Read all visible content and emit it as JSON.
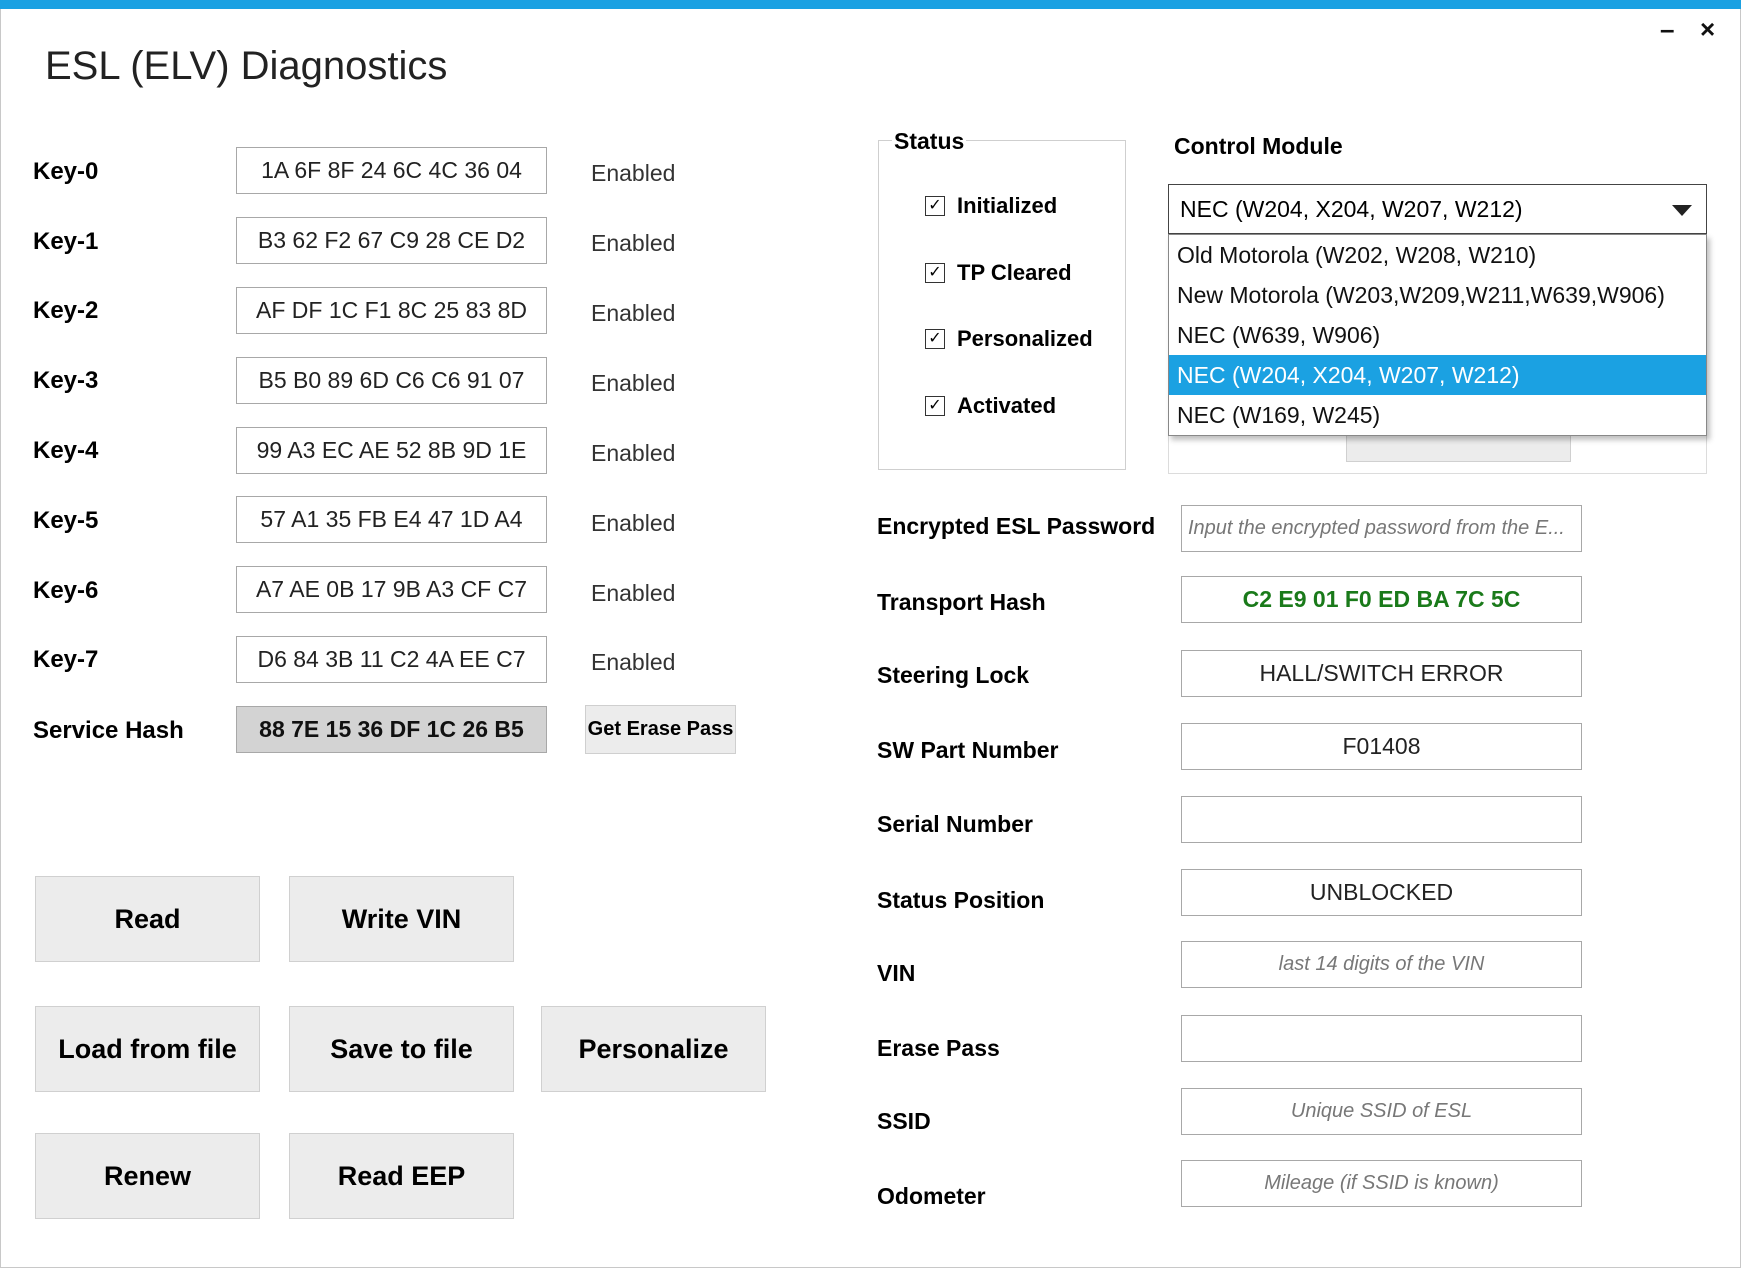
{
  "window": {
    "title": "ESL (ELV) Diagnostics",
    "minimize_label": "–",
    "close_label": "×",
    "accent_color": "#1ba1e2"
  },
  "keys": [
    {
      "label": "Key-0",
      "value": "1A 6F 8F 24 6C 4C 36 04",
      "status": "Enabled"
    },
    {
      "label": "Key-1",
      "value": "B3 62 F2 67 C9 28 CE D2",
      "status": "Enabled"
    },
    {
      "label": "Key-2",
      "value": "AF DF 1C F1 8C 25 83 8D",
      "status": "Enabled"
    },
    {
      "label": "Key-3",
      "value": "B5 B0 89 6D C6 C6 91 07",
      "status": "Enabled"
    },
    {
      "label": "Key-4",
      "value": "99 A3 EC AE 52 8B 9D 1E",
      "status": "Enabled"
    },
    {
      "label": "Key-5",
      "value": "57 A1 35 FB E4 47 1D A4",
      "status": "Enabled"
    },
    {
      "label": "Key-6",
      "value": "A7 AE 0B 17 9B A3 CF C7",
      "status": "Enabled"
    },
    {
      "label": "Key-7",
      "value": "D6 84 3B 11 C2 4A EE C7",
      "status": "Enabled"
    }
  ],
  "service_hash": {
    "label": "Service Hash",
    "value": "88 7E 15 36 DF 1C 26 B5",
    "button_label": "Get Erase Pass"
  },
  "buttons": {
    "read": "Read",
    "write_vin": "Write VIN",
    "load_from_file": "Load from file",
    "save_to_file": "Save to file",
    "personalize": "Personalize",
    "renew": "Renew",
    "read_eep": "Read EEP"
  },
  "status_group": {
    "title": "Status",
    "items": [
      {
        "label": "Initialized",
        "checked": true
      },
      {
        "label": "TP Cleared",
        "checked": true
      },
      {
        "label": "Personalized",
        "checked": true
      },
      {
        "label": "Activated",
        "checked": true
      }
    ],
    "check_glyph": "✓"
  },
  "control_module": {
    "label": "Control Module",
    "selected": "NEC (W204, X204, W207, W212)",
    "options": [
      "Old Motorola (W202, W208, W210)",
      "New Motorola (W203,W209,W211,W639,W906)",
      "NEC (W639, W906)",
      "NEC (W204, X204, W207, W212)",
      "NEC (W169, W245)"
    ],
    "selected_index": 3
  },
  "fields": {
    "encrypted_password": {
      "label": "Encrypted ESL Password",
      "value": "",
      "placeholder": "Input the encrypted password from the E..."
    },
    "transport_hash": {
      "label": "Transport Hash",
      "value": "C2 E9 01 F0 ED BA 7C 5C"
    },
    "steering_lock": {
      "label": "Steering Lock",
      "value": "HALL/SWITCH ERROR"
    },
    "sw_part_number": {
      "label": "SW Part Number",
      "value": "F01408"
    },
    "serial_number": {
      "label": "Serial Number",
      "value": ""
    },
    "status_position": {
      "label": "Status Position",
      "value": "UNBLOCKED"
    },
    "vin": {
      "label": "VIN",
      "value": "",
      "placeholder": "last 14 digits of the VIN"
    },
    "erase_pass": {
      "label": "Erase Pass",
      "value": ""
    },
    "ssid": {
      "label": "SSID",
      "value": "",
      "placeholder": "Unique SSID of ESL"
    },
    "odometer": {
      "label": "Odometer",
      "value": "",
      "placeholder": "Mileage (if SSID is known)"
    }
  }
}
